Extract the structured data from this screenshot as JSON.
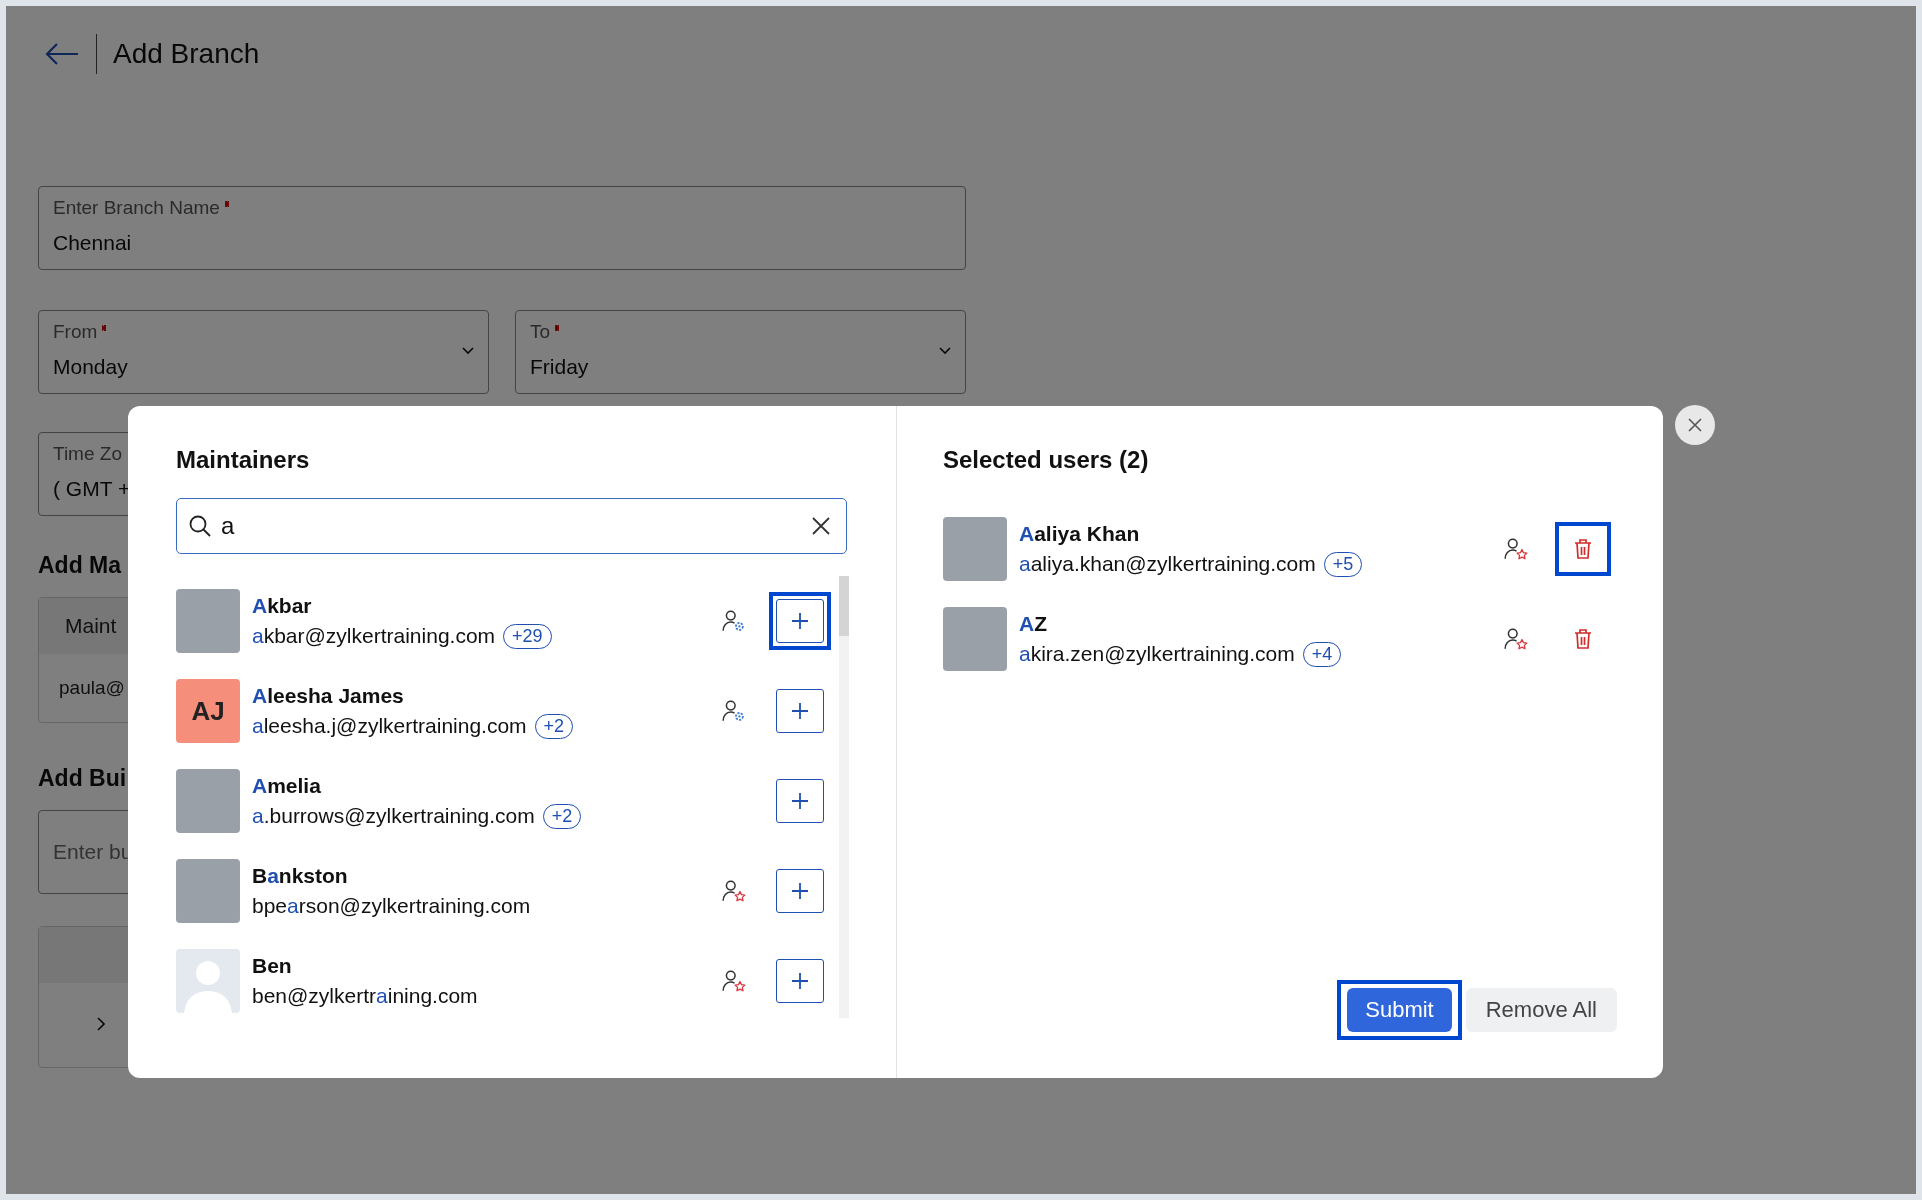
{
  "header": {
    "title": "Add Branch"
  },
  "form": {
    "branch_name": {
      "label": "Enter Branch Name",
      "required": true,
      "value": "Chennai"
    },
    "from": {
      "label": "From",
      "required": true,
      "value": "Monday"
    },
    "to": {
      "label": "To",
      "required": true,
      "value": "Friday"
    },
    "time_zone": {
      "label": "Time Zo",
      "value": "( GMT +"
    }
  },
  "maintainers_section": {
    "heading": "Add Ma",
    "table_header": "Maint",
    "row": "paula@"
  },
  "buildings_section": {
    "heading": "Add Bui",
    "placeholder": "Enter bu"
  },
  "dialog": {
    "left": {
      "title": "Maintainers",
      "search": {
        "value": "a"
      },
      "users": [
        {
          "avatar": {
            "kind": "photo"
          },
          "name": [
            {
              "text": "A",
              "match": true
            },
            {
              "text": "kbar",
              "match": false
            }
          ],
          "email": [
            {
              "text": "a",
              "match": true
            },
            {
              "text": "kbar@zylkertraining.com",
              "match": false
            }
          ],
          "badge": "+29",
          "role": {
            "kind": "gear"
          },
          "highlighted": true
        },
        {
          "avatar": {
            "kind": "initials",
            "initials": "AJ"
          },
          "name": [
            {
              "text": "A",
              "match": true
            },
            {
              "text": "leesha James",
              "match": false
            }
          ],
          "email": [
            {
              "text": "a",
              "match": true
            },
            {
              "text": "leesha.j@zylkertraining.com",
              "match": false
            }
          ],
          "badge": "+2",
          "role": {
            "kind": "gear"
          },
          "highlighted": false
        },
        {
          "avatar": {
            "kind": "photo"
          },
          "name": [
            {
              "text": "A",
              "match": true
            },
            {
              "text": "melia",
              "match": false
            }
          ],
          "email": [
            {
              "text": "a",
              "match": true
            },
            {
              "text": ".burrows@zylkertraining.com",
              "match": false
            }
          ],
          "badge": "+2",
          "highlighted": false
        },
        {
          "avatar": {
            "kind": "photo"
          },
          "name": [
            {
              "text": "B",
              "match": false
            },
            {
              "text": "a",
              "match": true
            },
            {
              "text": "nkston",
              "match": false
            }
          ],
          "email": [
            {
              "text": "bpe",
              "match": false
            },
            {
              "text": "a",
              "match": true
            },
            {
              "text": "rson@zylkertraining.com",
              "match": false
            }
          ],
          "role": {
            "kind": "star"
          },
          "highlighted": false
        },
        {
          "avatar": {
            "kind": "default"
          },
          "name": [
            {
              "text": "Ben",
              "match": false
            }
          ],
          "email": [
            {
              "text": "ben@zylkertr",
              "match": false
            },
            {
              "text": "a",
              "match": true
            },
            {
              "text": "ining.com",
              "match": false
            }
          ],
          "role": {
            "kind": "star"
          },
          "highlighted": false
        }
      ]
    },
    "right": {
      "title": "Selected users (2)",
      "users": [
        {
          "avatar": {
            "kind": "photo"
          },
          "name": [
            {
              "text": "A",
              "match": true
            },
            {
              "text": "aliya Khan",
              "match": false
            }
          ],
          "email": [
            {
              "text": "a",
              "match": true
            },
            {
              "text": "aliya.khan@zylkertraining.com",
              "match": false
            }
          ],
          "badge": "+5",
          "role": {
            "kind": "star"
          },
          "highlighted": true
        },
        {
          "avatar": {
            "kind": "photo"
          },
          "name": [
            {
              "text": "A",
              "match": true
            },
            {
              "text": "Z",
              "match": false
            }
          ],
          "email": [
            {
              "text": "a",
              "match": true
            },
            {
              "text": "kira.zen@zylkertraining.com",
              "match": false
            }
          ],
          "badge": "+4",
          "role": {
            "kind": "star"
          },
          "highlighted": false
        }
      ],
      "submit": {
        "label": "Submit",
        "highlighted": true
      },
      "remove_all": "Remove All"
    }
  }
}
